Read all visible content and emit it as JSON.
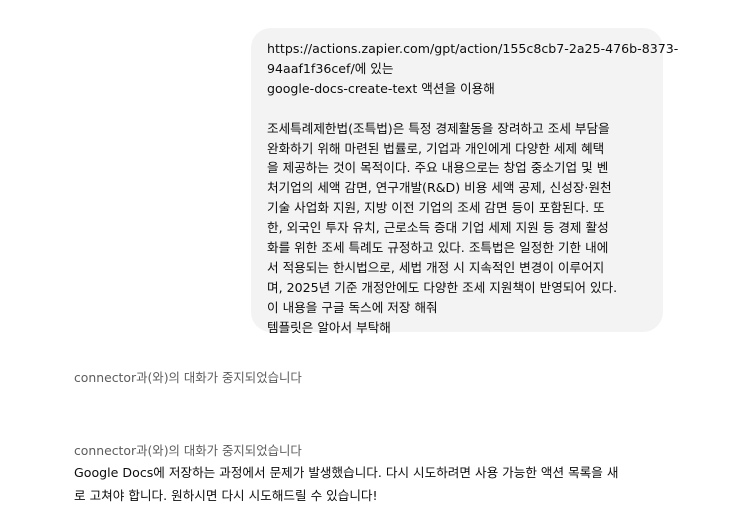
{
  "user_message": {
    "lines_a": [
      "https://actions.zapier.com/gpt/action/155c8cb7-2a25-476b-8373-",
      "94aaf1f36cef/에 있는",
      "google-docs-create-text 액션을 이용해"
    ],
    "lines_b": [
      "조세특례제한법(조특법)은 특정 경제활동을 장려하고 조세 부담을",
      "완화하기 위해 마련된 법률로, 기업과 개인에게 다양한 세제 혜택",
      "을 제공하는 것이 목적이다. 주요 내용으로는 창업 중소기업 및 벤",
      "처기업의 세액 감면, 연구개발(R&D) 비용 세액 공제, 신성장·원천",
      "기술 사업화 지원, 지방 이전 기업의 조세 감면 등이 포함된다. 또",
      "한, 외국인 투자 유치, 근로소득 증대 기업 세제 지원 등 경제 활성",
      "화를 위한 조세 특례도 규정하고 있다. 조특법은 일정한 기한 내에",
      "서 적용되는 한시법으로, 세법 개정 시 지속적인 변경이 이루어지",
      "며, 2025년 기준 개정안에도 다양한 조세 지원책이 반영되어 있다.",
      "이 내용을 구글 독스에 저장 해줘",
      "템플릿은 알아서 부탁해"
    ]
  },
  "status_1": "connector과(와)의 대화가 중지되었습니다",
  "status_2": "connector과(와)의 대화가 중지되었습니다",
  "assistant_message": {
    "lines": [
      "Google Docs에 저장하는 과정에서 문제가 발생했습니다. 다시 시도하려면 사용 가능한 액션 목록을 새",
      "로 고쳐야 합니다. 원하시면 다시 시도해드릴 수 있습니다!"
    ]
  }
}
